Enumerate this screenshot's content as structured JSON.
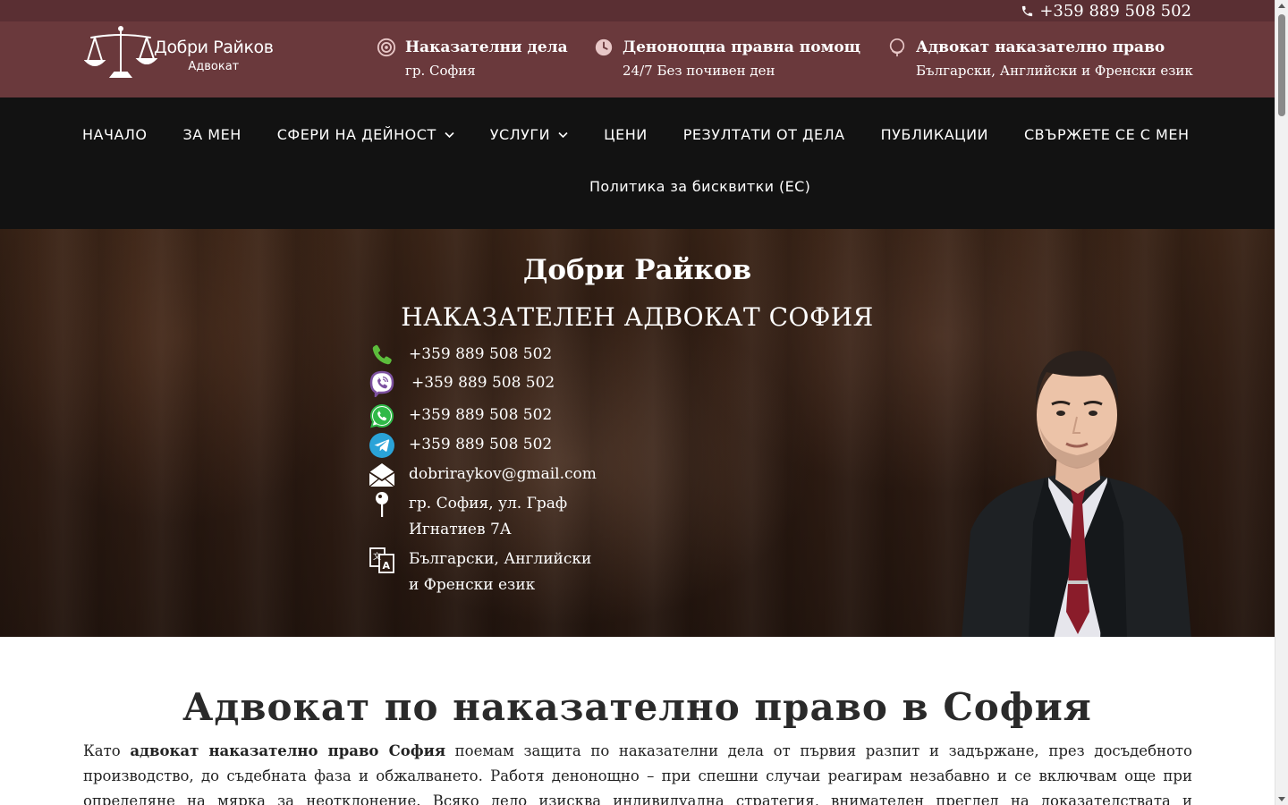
{
  "topbar": {
    "phone": "+359 889 508 502",
    "icon": "phone-icon"
  },
  "logo": {
    "name": "Добри Райков",
    "subtitle": "Адвокат",
    "icon": "scales-of-justice-icon"
  },
  "header_info": [
    {
      "title": "Наказателни дела",
      "subtitle": "гр. София",
      "icon": "target-icon"
    },
    {
      "title": "Денонощна правна помощ",
      "subtitle": "24/7 Без почивен ден",
      "icon": "clock-icon"
    },
    {
      "title": "Адвокат наказателно право",
      "subtitle": "Български, Английски и Френски език",
      "icon": "globe-icon"
    }
  ],
  "nav": {
    "items": [
      {
        "label": "НАЧАЛО",
        "dropdown": false
      },
      {
        "label": "ЗА МЕН",
        "dropdown": false
      },
      {
        "label": "СФЕРИ НА ДЕЙНОСТ",
        "dropdown": true
      },
      {
        "label": "УСЛУГИ",
        "dropdown": true
      },
      {
        "label": "ЦЕНИ",
        "dropdown": false
      },
      {
        "label": "РЕЗУЛТАТИ ОТ ДЕЛА",
        "dropdown": false
      },
      {
        "label": "ПУБЛИКАЦИИ",
        "dropdown": false
      },
      {
        "label": "СВЪРЖЕТЕ СЕ С МЕН",
        "dropdown": false
      }
    ],
    "second_row": "Политика за бисквитки (ЕС)"
  },
  "hero": {
    "name": "Добри Райков",
    "subtitle": "НАКАЗАТЕЛЕН АДВОКАТ СОФИЯ",
    "contacts": {
      "phone": "+359 889 508 502",
      "viber": "+359 889 508 502",
      "whatsapp": "+359 889 508 502",
      "telegram": "+359 889 508 502",
      "email": "dobriraykov@gmail.com",
      "address_line1": "гр. София, ул. Граф",
      "address_line2": "Игнатиев 7А",
      "languages_line1": "Български, Английски",
      "languages_line2": "и Френски език"
    }
  },
  "main": {
    "title": "Адвокат по наказателно право в София",
    "para_lead": "Като ",
    "para_bold": "адвокат наказателно право София",
    "para_rest": " поемам защита по наказателни дела от първия разпит и задържане, през досъдебното производство, до съдебната фаза и обжалването. Работя денонощно – при спешни случаи реагирам незабавно и се включвам още при определяне на мярка за неотклонение. Всяко дело изисква индивидуална стратегия, внимателен преглед на доказателствата и последователна"
  },
  "colors": {
    "topbar": "#5a2f33",
    "header": "#6a393c",
    "nav": "#121212",
    "hero": "#2d1b12"
  }
}
